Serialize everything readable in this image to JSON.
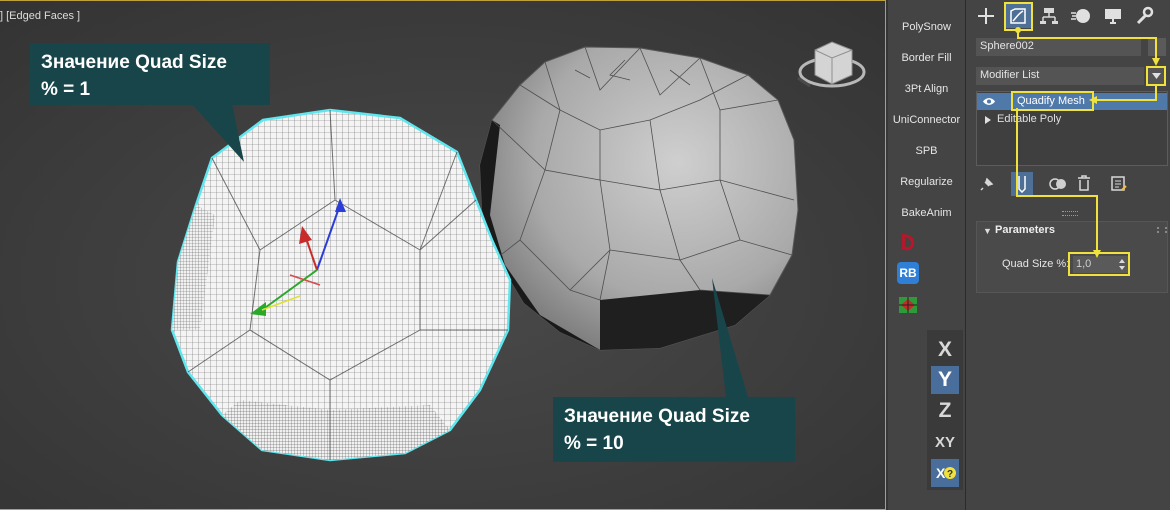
{
  "viewport": {
    "label": "] [Edged Faces ]",
    "callouts": [
      {
        "line1": "Значение Quad Size",
        "line2": "% = 1"
      },
      {
        "line1": "Значение Quad Size",
        "line2": "% = 10"
      }
    ]
  },
  "toolbar": {
    "buttons": [
      "PolySnow",
      "Border Fill",
      "3Pt Align",
      "UniConnector",
      "SPB",
      "Regularize",
      "BakeAnim"
    ],
    "icon_buttons": [
      "d-script-icon",
      "rb-icon",
      "grid-plugin-icon"
    ],
    "rb_label": "RB",
    "axis_constraints": [
      "X",
      "Y",
      "Z",
      "XY"
    ],
    "active_axis": "Y"
  },
  "command_panel": {
    "tabs": [
      "create-tab",
      "modify-tab",
      "hierarchy-tab",
      "motion-tab",
      "display-tab",
      "utilities-tab"
    ],
    "active_tab": "modify-tab",
    "object_name": "Sphere002",
    "modifier_list_label": "Modifier List",
    "modifier_stack": [
      {
        "label": "Quadify Mesh",
        "selected": true
      },
      {
        "label": "Editable Poly",
        "selected": false
      }
    ],
    "stack_tools": [
      "pin-stack-icon",
      "show-end-result-icon",
      "make-unique-icon",
      "remove-modifier-icon",
      "configure-modifier-sets-icon"
    ],
    "parameters": {
      "title": "Parameters",
      "quad_size_label": "Quad Size %:",
      "quad_size_value": "1,0"
    }
  },
  "colors": {
    "accent_highlight": "#f0e13c",
    "callout_bg": "#18454a",
    "selection_outline": "#5fe6ee",
    "selected_modifier": "#4f79a8",
    "active_tab": "#4e6f96",
    "viewport_border": "#bfa13a"
  }
}
